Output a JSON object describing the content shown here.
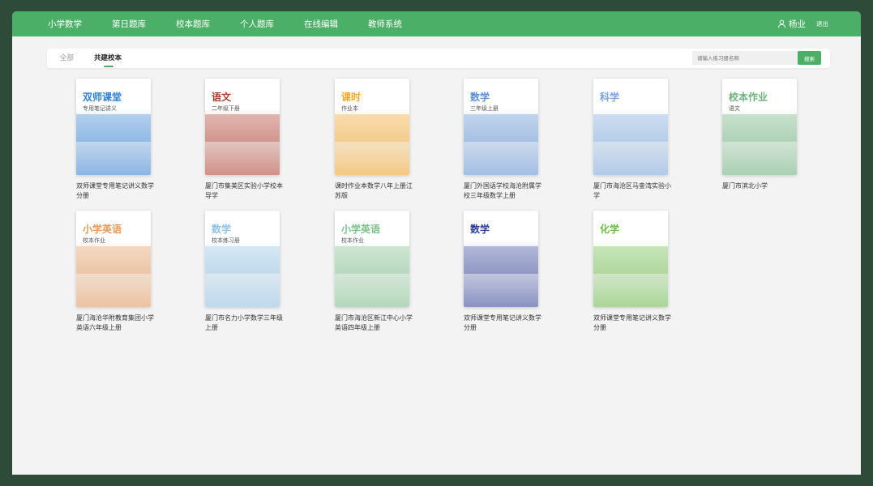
{
  "nav": {
    "items": [
      {
        "label": "小学数学"
      },
      {
        "label": "第日题库"
      },
      {
        "label": "校本题库"
      },
      {
        "label": "个人题库"
      },
      {
        "label": "在线编辑"
      },
      {
        "label": "教师系统"
      }
    ],
    "user_name": "杨业",
    "logout_label": "退出"
  },
  "tabs": {
    "all": "全部",
    "school": "共建校本"
  },
  "search": {
    "placeholder": "请输入练习册名称",
    "button": "搜索"
  },
  "books": [
    {
      "title": "双师课堂专用笔记讲义数学分册",
      "cover_text": "双师课堂",
      "cover_sub": "专用笔记讲义",
      "theme": "#2f80d9"
    },
    {
      "title": "厦门市集美区实验小学校本导学",
      "cover_text": "语文",
      "cover_sub": "二年级下册",
      "theme": "#b23a2a"
    },
    {
      "title": "课时作业本数学八年上册江苏版",
      "cover_text": "课时",
      "cover_sub": "作业本",
      "theme": "#f5a623"
    },
    {
      "title": "厦门外国语学校海沧附属学校三年级数学上册",
      "cover_text": "数学",
      "cover_sub": "三年级上册",
      "theme": "#5b8fd6"
    },
    {
      "title": "厦门市海沧区马銮湾实验小学",
      "cover_text": "科学",
      "cover_sub": "",
      "theme": "#7aa7e0"
    },
    {
      "title": "厦门市滨北小学",
      "cover_text": "校本作业",
      "cover_sub": "语文",
      "theme": "#6cb27a"
    },
    {
      "title": "厦门海沧华附教育集团小学英语六年级上册",
      "cover_text": "小学英语",
      "cover_sub": "校本作业",
      "theme": "#e8995a"
    },
    {
      "title": "厦门市名力小学数学三年级上册",
      "cover_text": "数学",
      "cover_sub": "校本练习册",
      "theme": "#8fc3e8"
    },
    {
      "title": "厦门市海沧区新江中心小学英语四年级上册",
      "cover_text": "小学英语",
      "cover_sub": "校本作业",
      "theme": "#7cc08a"
    },
    {
      "title": "双师课堂专用笔记讲义数学分册",
      "cover_text": "数学",
      "cover_sub": "",
      "theme": "#2c3e9a"
    },
    {
      "title": "双师课堂专用笔记讲义数学分册",
      "cover_text": "化学",
      "cover_sub": "",
      "theme": "#6bbd46"
    }
  ]
}
